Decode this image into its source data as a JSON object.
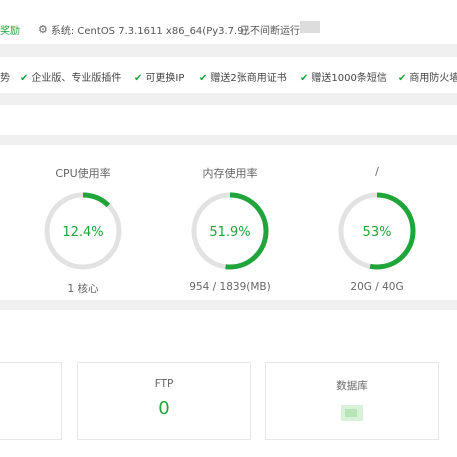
{
  "topbar": {
    "reward": "奖励",
    "system": "系统:  CentOS 7.3.1611 x86_64(Py3.7.9)",
    "uptime": "已不间断运行"
  },
  "features": [
    "势",
    "企业版、专业版插件",
    "可更换IP",
    "赠送2张商用证书",
    "赠送1000条短信",
    "商用防火墙"
  ],
  "gauges": [
    {
      "title": "CPU使用率",
      "value_text": "12.4%",
      "percent": 12.4,
      "footer": "1 核心"
    },
    {
      "title": "内存使用率",
      "value_text": "51.9%",
      "percent": 51.9,
      "footer": "954 / 1839(MB)"
    },
    {
      "title": "/",
      "value_text": "53%",
      "percent": 53,
      "footer": "20G / 40G"
    }
  ],
  "boxes": {
    "ftp_label": "FTP",
    "ftp_value": "0",
    "db_label": "数据库"
  },
  "colors": {
    "accent": "#20a53a",
    "track": "#e2e2e2"
  }
}
